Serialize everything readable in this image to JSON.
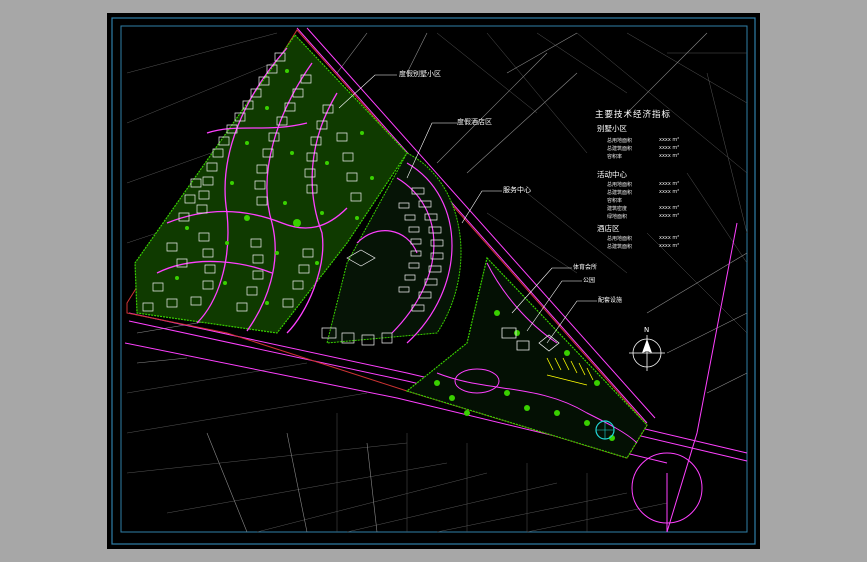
{
  "labels": {
    "villa_area": "度假别墅小区",
    "hotel": "度假酒店区",
    "service_center": "服务中心",
    "sports_club": "体育会所",
    "park": "公园",
    "amenities": "配套设施"
  },
  "legend": {
    "title": "主要技术经济指标",
    "sections": [
      {
        "heading": "别墅小区",
        "rows": [
          {
            "k": "总用地面积",
            "v": "xxxx m²"
          },
          {
            "k": "总建筑面积",
            "v": "xxxx m²"
          },
          {
            "k": "容积率",
            "v": "xxxx m²"
          }
        ]
      },
      {
        "heading": "活动中心",
        "rows": [
          {
            "k": "总用地面积",
            "v": "xxxx m²"
          },
          {
            "k": "总建筑面积",
            "v": "xxxx m²"
          },
          {
            "k": "容积率",
            "v": ""
          },
          {
            "k": "建筑密度",
            "v": "xxxx m²"
          },
          {
            "k": "绿地面积",
            "v": "xxxx m²"
          }
        ]
      },
      {
        "heading": "酒店区",
        "rows": [
          {
            "k": "总用地面积",
            "v": "xxxx m²"
          },
          {
            "k": "总建筑面积",
            "v": "xxxx m²"
          }
        ]
      }
    ]
  },
  "north": "N",
  "colors": {
    "background": "#000000",
    "frame": "#a7a7a7",
    "border": "#2f7fa8",
    "road": "#ff40ff",
    "lot": "#ffffff",
    "vegetation": "#39d000",
    "yellow": "#ffff00"
  }
}
